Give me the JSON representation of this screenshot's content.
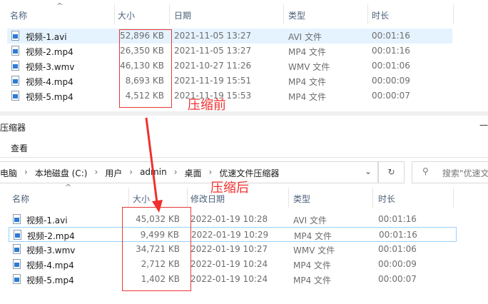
{
  "columns_before": {
    "name": "名称",
    "size": "大小",
    "date": "日期",
    "type": "类型",
    "duration": "时长"
  },
  "files_before": [
    {
      "name": "视频-1.avi",
      "size": "52,896 KB",
      "date": "2021-11-05 13:27",
      "type": "AVI 文件",
      "duration": "00:01:16"
    },
    {
      "name": "视频-2.mp4",
      "size": "26,350 KB",
      "date": "2021-11-05 13:27",
      "type": "MP4 文件",
      "duration": "00:01:16"
    },
    {
      "name": "视频-3.wmv",
      "size": "46,130 KB",
      "date": "2021-10-27 11:26",
      "type": "WMV 文件",
      "duration": "00:01:06"
    },
    {
      "name": "视频-4.mp4",
      "size": "8,693 KB",
      "date": "2021-11-19 15:51",
      "type": "MP4 文件",
      "duration": "00:00:09"
    },
    {
      "name": "视频-5.mp4",
      "size": "4,512 KB",
      "date": "2021-11-19 15:53",
      "type": "MP4 文件",
      "duration": "00:00:07"
    }
  ],
  "label_before": "压缩前",
  "label_after": "压缩后",
  "window": {
    "title": "压缩器",
    "minimize": "—",
    "menu_view": "查看"
  },
  "breadcrumb": [
    "电脑",
    "本地磁盘 (C:)",
    "用户",
    "admin",
    "桌面",
    "优速文件压缩器"
  ],
  "search_placeholder": "搜索\"优速文",
  "columns_after": {
    "name": "名称",
    "size": "大小",
    "date": "修改日期",
    "type": "类型",
    "duration": "时长"
  },
  "files_after": [
    {
      "name": "视频-1.avi",
      "size": "45,032 KB",
      "date": "2022-01-19 10:28",
      "type": "AVI 文件",
      "duration": "00:01:16"
    },
    {
      "name": "视频-2.mp4",
      "size": "9,499 KB",
      "date": "2022-01-19 10:29",
      "type": "MP4 文件",
      "duration": "00:01:16"
    },
    {
      "name": "视频-3.wmv",
      "size": "34,721 KB",
      "date": "2022-01-19 10:27",
      "type": "WMV 文件",
      "duration": "00:01:06"
    },
    {
      "name": "视频-4.mp4",
      "size": "2,712 KB",
      "date": "2022-01-19 10:24",
      "type": "MP4 文件",
      "duration": "00:00:09"
    },
    {
      "name": "视频-5.mp4",
      "size": "1,402 KB",
      "date": "2022-01-19 10:24",
      "type": "MP4 文件",
      "duration": "00:00:07"
    }
  ],
  "colors": {
    "annotation": "#f0302e",
    "selection": "#e5f3ff",
    "focus_border": "#99d1ff"
  }
}
